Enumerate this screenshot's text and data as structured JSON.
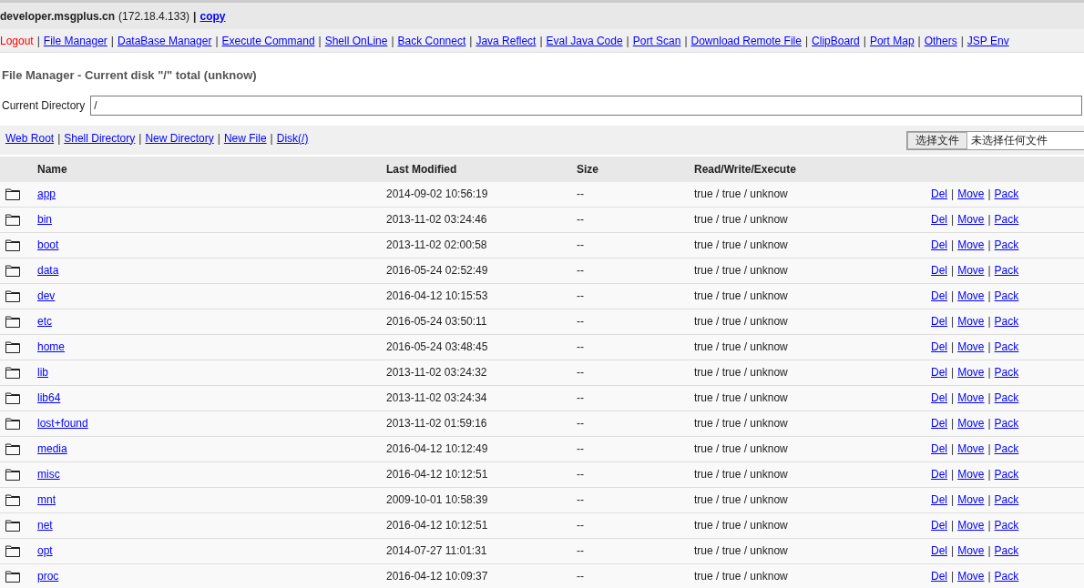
{
  "header": {
    "host": "developer.msgplus.cn",
    "ip": "(172.18.4.133)",
    "separator": "|",
    "copy_link": "copy"
  },
  "nav": [
    {
      "label": "Logout",
      "kind": "logout"
    },
    {
      "label": "File Manager",
      "kind": "link"
    },
    {
      "label": "DataBase Manager",
      "kind": "link"
    },
    {
      "label": "Execute Command",
      "kind": "link"
    },
    {
      "label": "Shell OnLine",
      "kind": "link"
    },
    {
      "label": "Back Connect",
      "kind": "link"
    },
    {
      "label": "Java Reflect",
      "kind": "link"
    },
    {
      "label": "Eval Java Code",
      "kind": "link"
    },
    {
      "label": "Port Scan",
      "kind": "link"
    },
    {
      "label": "Download Remote File",
      "kind": "link"
    },
    {
      "label": "ClipBoard",
      "kind": "link"
    },
    {
      "label": "Port Map",
      "kind": "link"
    },
    {
      "label": "Others",
      "kind": "link"
    },
    {
      "label": "JSP Env",
      "kind": "link"
    }
  ],
  "separator": "|",
  "title": "File Manager - Current disk \"/\" total (unknow)",
  "current_directory": {
    "label": "Current Directory",
    "value": "/"
  },
  "toolbar_links": [
    "Web Root",
    "Shell Directory",
    "New Directory",
    "New File",
    "Disk(/)"
  ],
  "file_input": {
    "button": "选择文件",
    "status": "未选择任何文件"
  },
  "table": {
    "columns": [
      "Name",
      "Last Modified",
      "Size",
      "Read/Write/Execute"
    ],
    "rows": [
      {
        "name": "app",
        "modified": "2014-09-02 10:56:19",
        "size": "--",
        "rwx": "true / true / unknow",
        "actions": [
          "Del",
          "Move",
          "Pack"
        ]
      },
      {
        "name": "bin",
        "modified": "2013-11-02 03:24:46",
        "size": "--",
        "rwx": "true / true / unknow",
        "actions": [
          "Del",
          "Move",
          "Pack"
        ]
      },
      {
        "name": "boot",
        "modified": "2013-11-02 02:00:58",
        "size": "--",
        "rwx": "true / true / unknow",
        "actions": [
          "Del",
          "Move",
          "Pack"
        ]
      },
      {
        "name": "data",
        "modified": "2016-05-24 02:52:49",
        "size": "--",
        "rwx": "true / true / unknow",
        "actions": [
          "Del",
          "Move",
          "Pack"
        ]
      },
      {
        "name": "dev",
        "modified": "2016-04-12 10:15:53",
        "size": "--",
        "rwx": "true / true / unknow",
        "actions": [
          "Del",
          "Move",
          "Pack"
        ]
      },
      {
        "name": "etc",
        "modified": "2016-05-24 03:50:11",
        "size": "--",
        "rwx": "true / true / unknow",
        "actions": [
          "Del",
          "Move",
          "Pack"
        ]
      },
      {
        "name": "home",
        "modified": "2016-05-24 03:48:45",
        "size": "--",
        "rwx": "true / true / unknow",
        "actions": [
          "Del",
          "Move",
          "Pack"
        ]
      },
      {
        "name": "lib",
        "modified": "2013-11-02 03:24:32",
        "size": "--",
        "rwx": "true / true / unknow",
        "actions": [
          "Del",
          "Move",
          "Pack"
        ]
      },
      {
        "name": "lib64",
        "modified": "2013-11-02 03:24:34",
        "size": "--",
        "rwx": "true / true / unknow",
        "actions": [
          "Del",
          "Move",
          "Pack"
        ]
      },
      {
        "name": "lost+found",
        "modified": "2013-11-02 01:59:16",
        "size": "--",
        "rwx": "true / true / unknow",
        "actions": [
          "Del",
          "Move",
          "Pack"
        ]
      },
      {
        "name": "media",
        "modified": "2016-04-12 10:12:49",
        "size": "--",
        "rwx": "true / true / unknow",
        "actions": [
          "Del",
          "Move",
          "Pack"
        ]
      },
      {
        "name": "misc",
        "modified": "2016-04-12 10:12:51",
        "size": "--",
        "rwx": "true / true / unknow",
        "actions": [
          "Del",
          "Move",
          "Pack"
        ]
      },
      {
        "name": "mnt",
        "modified": "2009-10-01 10:58:39",
        "size": "--",
        "rwx": "true / true / unknow",
        "actions": [
          "Del",
          "Move",
          "Pack"
        ]
      },
      {
        "name": "net",
        "modified": "2016-04-12 10:12:51",
        "size": "--",
        "rwx": "true / true / unknow",
        "actions": [
          "Del",
          "Move",
          "Pack"
        ]
      },
      {
        "name": "opt",
        "modified": "2014-07-27 11:01:31",
        "size": "--",
        "rwx": "true / true / unknow",
        "actions": [
          "Del",
          "Move",
          "Pack"
        ]
      },
      {
        "name": "proc",
        "modified": "2016-04-12 10:09:37",
        "size": "--",
        "rwx": "true / true / unknow",
        "actions": [
          "Del",
          "Move",
          "Pack"
        ]
      }
    ]
  }
}
